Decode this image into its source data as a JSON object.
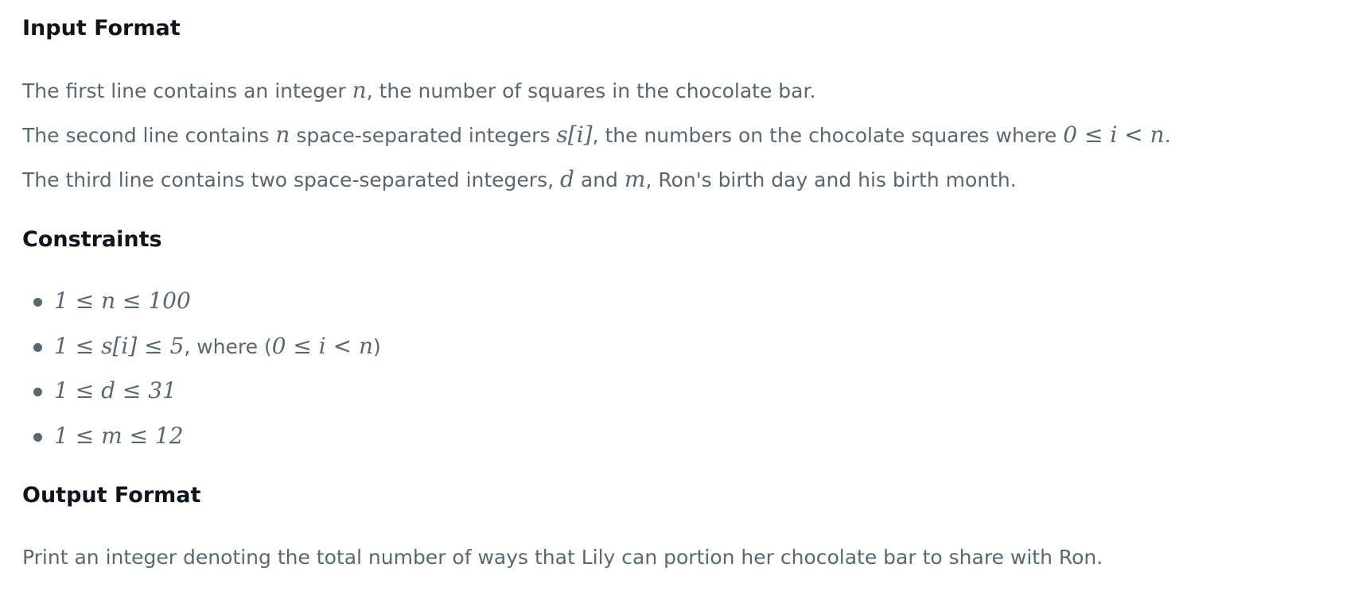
{
  "input_format": {
    "heading": "Input Format",
    "line1": {
      "pre": "The first line contains an integer ",
      "var_n": "n",
      "post": ", the number of squares in the chocolate bar."
    },
    "line2": {
      "pre": "The second line contains ",
      "var_n": "n",
      "mid": " space-separated integers ",
      "expr": "s[i]",
      "mid2": ", the numbers on the chocolate squares where ",
      "cond": "0 ≤ i < n",
      "post": "."
    },
    "line3": {
      "pre": "The third line contains two space-separated integers, ",
      "var_d": "d",
      "and": " and ",
      "var_m": "m",
      "post": ", Ron's birth day and his birth month."
    }
  },
  "constraints": {
    "heading": "Constraints",
    "items": [
      {
        "expr": "1 ≤ n ≤ 100",
        "text": ""
      },
      {
        "expr": "1 ≤ s[i] ≤ 5",
        "text_pre": ", where (",
        "cond": "0 ≤ i < n",
        "text_post": ")"
      },
      {
        "expr": "1 ≤ d ≤ 31",
        "text": ""
      },
      {
        "expr": "1 ≤ m ≤ 12",
        "text": ""
      }
    ]
  },
  "output_format": {
    "heading": "Output Format",
    "text": "Print an integer denoting the total number of ways that Lily can portion her chocolate bar to share with Ron."
  }
}
